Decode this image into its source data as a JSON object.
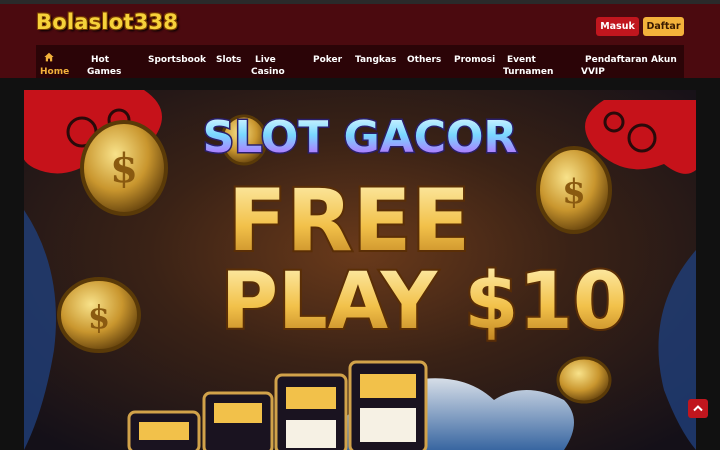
{
  "brand": {
    "logo_text": "Bolaslot338"
  },
  "auth": {
    "login_label": "Masuk",
    "register_label": "Daftar"
  },
  "nav": {
    "items": [
      {
        "line1": "Home",
        "line2": ""
      },
      {
        "line1": "Hot",
        "line2": "Games"
      },
      {
        "line1": "Sportsbook",
        "line2": ""
      },
      {
        "line1": "Slots",
        "line2": ""
      },
      {
        "line1": "Live",
        "line2": "Casino"
      },
      {
        "line1": "Poker",
        "line2": ""
      },
      {
        "line1": "Tangkas",
        "line2": ""
      },
      {
        "line1": "Others",
        "line2": ""
      },
      {
        "line1": "Promosi",
        "line2": ""
      },
      {
        "line1": "Event",
        "line2": "Turnamen"
      },
      {
        "line1": "Pendaftaran Akun",
        "line2": "VVIP"
      }
    ]
  },
  "banner": {
    "headline": "SLOT GACOR",
    "line1": "FREE",
    "line2": "PLAY $10"
  },
  "icons": {
    "home": "home-icon",
    "scroll_top": "chevron-up-icon"
  },
  "colors": {
    "header_bg": "#4b0a0f",
    "nav_bg": "#2b0407",
    "accent": "#f3b23b",
    "login_btn": "#c0161e"
  }
}
